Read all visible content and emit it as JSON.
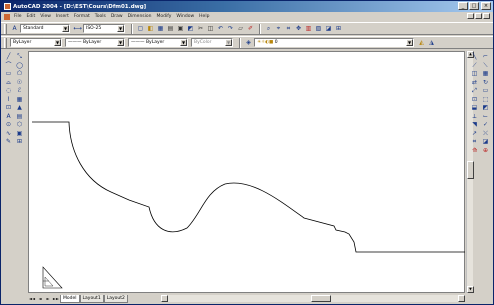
{
  "window": {
    "title": "AutoCAD 2004 - [D:\\EST\\Cours\\Dfm01.dwg]",
    "controls": [
      "_",
      "□",
      "×"
    ]
  },
  "menu": {
    "items": [
      "File",
      "Edit",
      "View",
      "Insert",
      "Format",
      "Tools",
      "Draw",
      "Dimension",
      "Modify",
      "Window",
      "Help"
    ]
  },
  "toolbar1": {
    "text_style": "Standard",
    "dim_style": "ISO-25",
    "icons": [
      "▢",
      "◧",
      "▦",
      "▤",
      "▣",
      "◩",
      "✂",
      "◫",
      "↶",
      "↷",
      "▱",
      "✐",
      "⌕",
      "⌖",
      "⌗",
      "✥",
      "▥",
      "▧",
      "◪",
      "⊞"
    ]
  },
  "toolbar2": {
    "layer": "0",
    "linetype": "ByLayer",
    "lineweight": "ByLayer",
    "color": "ByLayer",
    "plot_style": "ByColor",
    "layer_right": "0"
  },
  "draw_tools": [
    "╱",
    "⤡",
    "⌒",
    "◯",
    "▭",
    "⬠",
    "⌓",
    "☉",
    "◌",
    "ℰ",
    "⌇",
    "▦",
    "⊡",
    "▲",
    "A",
    "▤",
    "⊙",
    "⬡",
    "∿",
    "▣",
    "✎",
    "⊞"
  ],
  "modify_tools": [
    "╲",
    "⌐",
    "⟋",
    "⟍",
    "◫",
    "▦",
    "⇄",
    "↻",
    "⤢",
    "▭",
    "⊡",
    "⬚",
    "⬓",
    "◩",
    "⟂",
    "⌙",
    "◥",
    "✓",
    "↗",
    "⤬",
    "⌗",
    "◪",
    "⟰",
    "⊕"
  ],
  "tabs": {
    "nav": [
      "◄◄",
      "◄",
      "►",
      "►►"
    ],
    "items": [
      "Model",
      "Layout1",
      "Layout2"
    ],
    "active": "Model"
  }
}
